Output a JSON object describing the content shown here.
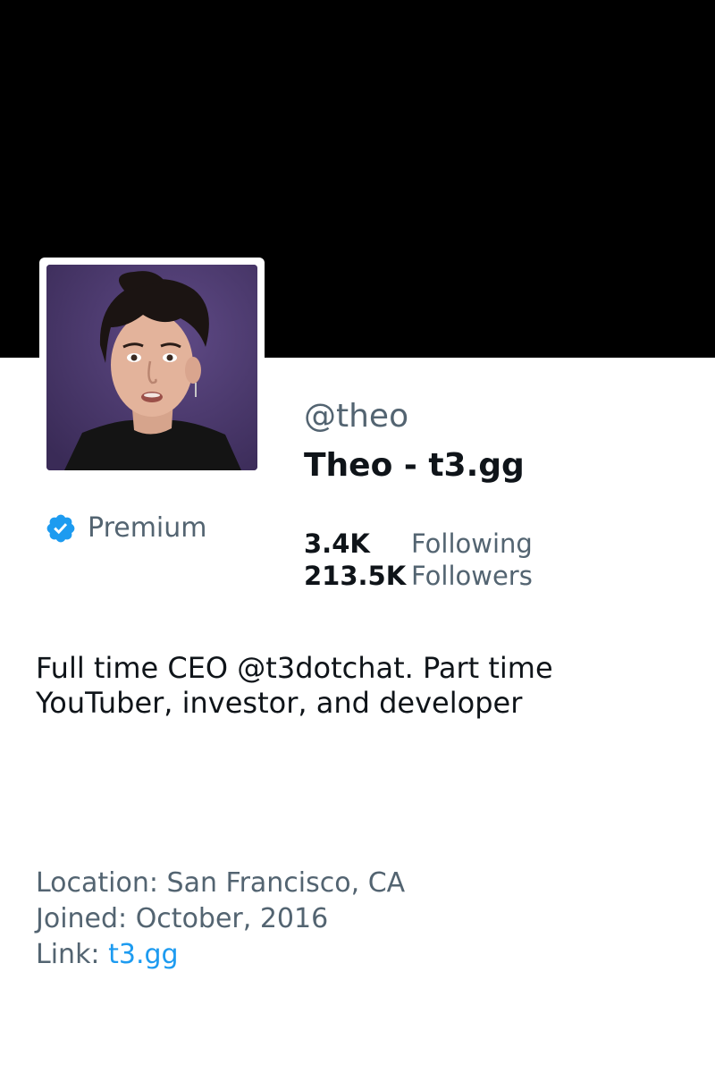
{
  "profile": {
    "handle": "@theo",
    "display_name": "Theo - t3.gg",
    "premium_label": "Premium",
    "bio": "Full time CEO @t3dotchat. Part time YouTuber, investor, and developer",
    "stats": {
      "following_count": "3.4K",
      "following_label": "Following",
      "followers_count": "213.5K",
      "followers_label": "Followers"
    },
    "meta": {
      "location": "Location: San Francisco, CA",
      "joined": "Joined: October, 2016",
      "link_label": "Link:",
      "link_text": "t3.gg"
    }
  },
  "icons": {
    "premium": "verified-badge-icon"
  },
  "colors": {
    "banner": "#000000",
    "text_primary": "#0f1419",
    "text_secondary": "#536471",
    "link": "#1d9bf0",
    "verified_badge": "#1d9bf0"
  }
}
